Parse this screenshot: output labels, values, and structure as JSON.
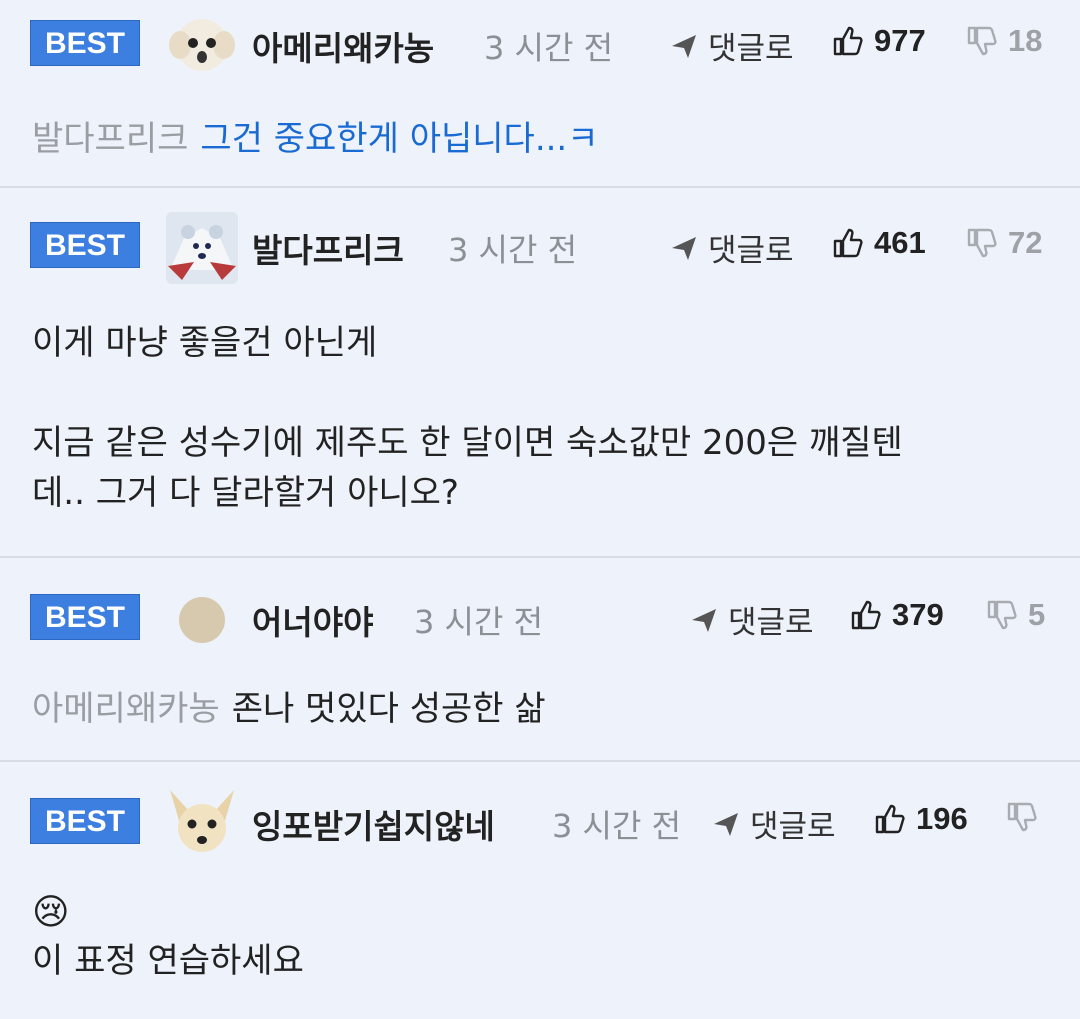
{
  "best_label": "BEST",
  "reply_label": "댓글로",
  "comments": [
    {
      "username": "아메리왜카농",
      "time": "3 시간 전",
      "likes": "977",
      "dislikes": "18",
      "mention": "발다프리크",
      "text": "그건 중요한게 아닙니다...ㅋ",
      "avatar": "dog-avatar"
    },
    {
      "username": "발다프리크",
      "time": "3 시간 전",
      "likes": "461",
      "dislikes": "72",
      "lines": [
        "이게 마냥 좋을건 아닌게",
        "지금 같은 성수기에 제주도 한 달이면 숙소값만 200은 깨질텐",
        "데.. 그거 다 달라할거 아니오?"
      ],
      "avatar": "bear-avatar"
    },
    {
      "username": "어너야야",
      "time": "3 시간 전",
      "likes": "379",
      "dislikes": "5",
      "mention": "아메리왜카농",
      "text": "존나 멋있다 성공한 삶",
      "avatar": "circle-avatar"
    },
    {
      "username": "잉포받기쉽지않네",
      "time": "3 시간 전",
      "likes": "196",
      "dislikes": "",
      "emoji": "😢",
      "text": "이 표정 연습하세요",
      "avatar": "chihuahua-avatar"
    }
  ]
}
